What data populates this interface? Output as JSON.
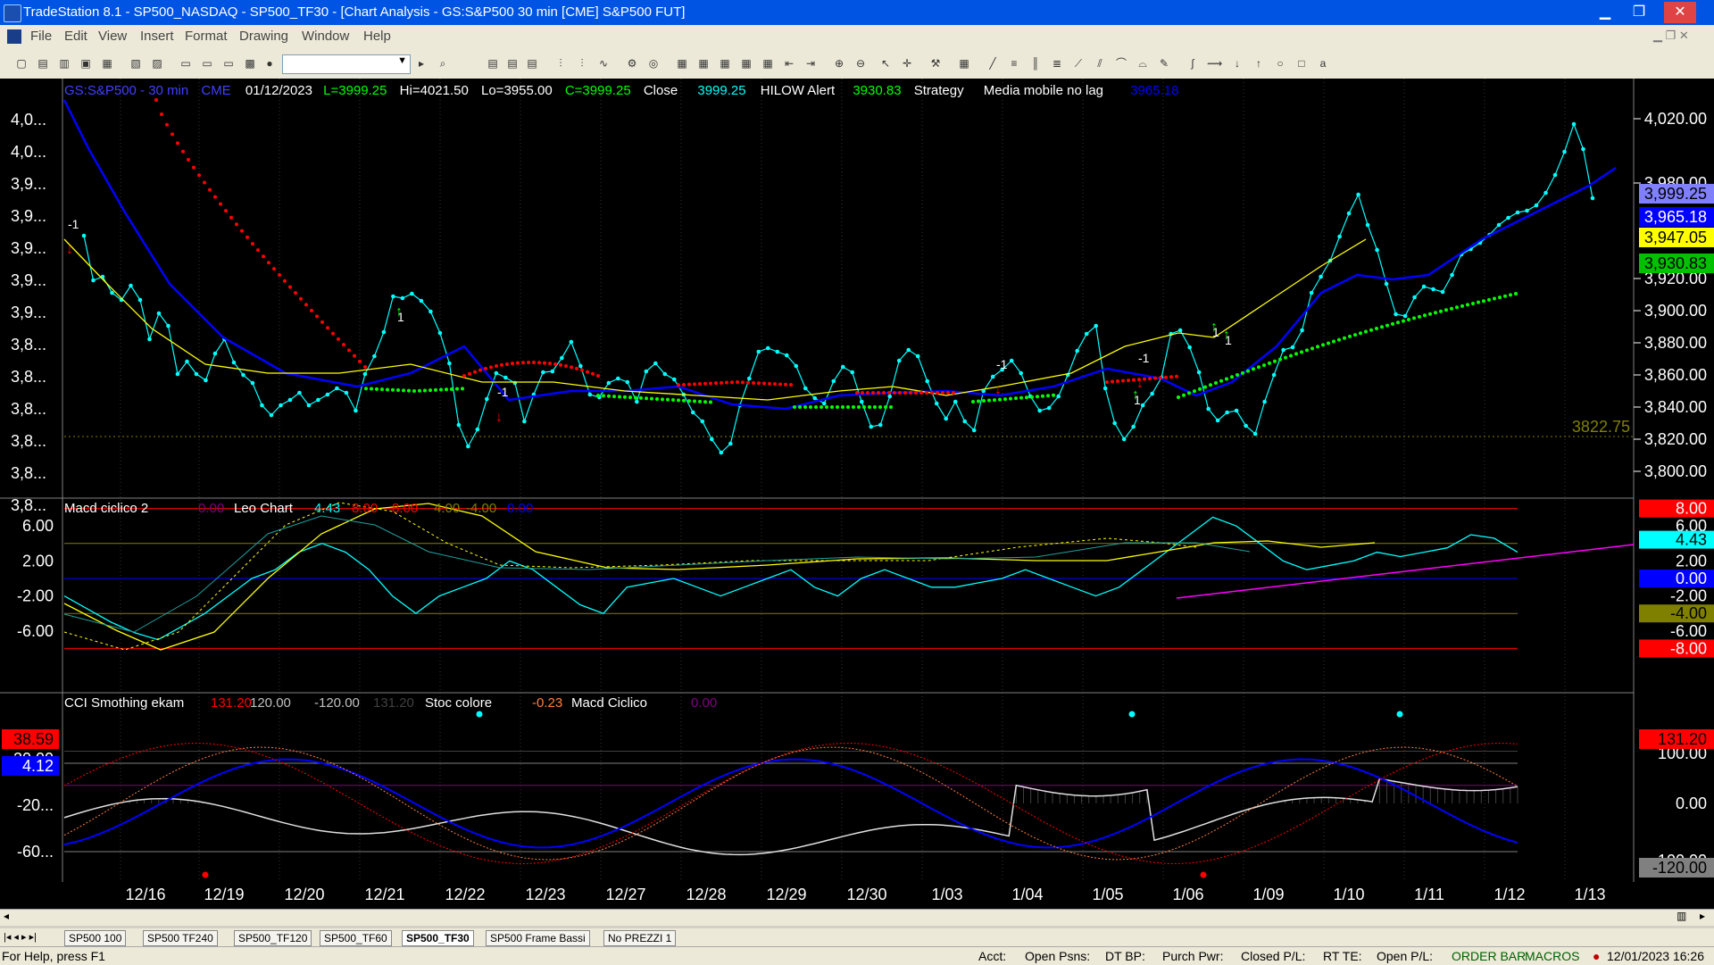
{
  "window": {
    "title": "TradeStation 8.1 - SP500_NASDAQ - SP500_TF30 - [Chart Analysis - GS:S&P500  30 min  [CME] S&P500 FUT]",
    "minimize": "▁",
    "restore": "❐",
    "close": "✕"
  },
  "menu": [
    "File",
    "Edit",
    "View",
    "Insert",
    "Format",
    "Drawing",
    "Window",
    "Help"
  ],
  "header": {
    "symbol": "GS:S&P500 - 30 min",
    "exchange": "CME",
    "date": "01/12/2023",
    "last": "L=3999.25",
    "hi": "Hi=4021.50",
    "lo": "Lo=3955.00",
    "close_eq": "C=3999.25",
    "close_label": "Close",
    "close_value": "3999.25",
    "hilow_label": "HILOW Alert",
    "hilow_value": "3930.83",
    "strategy_label": "Strategy",
    "media_label": "Media mobile no lag",
    "media_value": "3965.18"
  },
  "price_panel": {
    "right_ticks": [
      "4,020.00",
      "3,980.00",
      "3,920.00",
      "3,900.00",
      "3,880.00",
      "3,860.00",
      "3,840.00",
      "3,820.00",
      "3,800.00"
    ],
    "left_ticks": [
      "4,0...",
      "4,0...",
      "3,9...",
      "3,9...",
      "3,9...",
      "3,9...",
      "3,9...",
      "3,8...",
      "3,8...",
      "3,8...",
      "3,8...",
      "3,8...",
      "3,8..."
    ],
    "badges": [
      {
        "text": "3,999.25",
        "bg": "#8080ff",
        "fg": "#000000"
      },
      {
        "text": "3,965.18",
        "bg": "#0000ff",
        "fg": "#ffffff"
      },
      {
        "text": "3,947.05",
        "bg": "#ffff00",
        "fg": "#000000"
      },
      {
        "text": "3,930.83",
        "bg": "#00c000",
        "fg": "#000000"
      }
    ],
    "level_label": "3822.75",
    "signals": [
      {
        "label": "-1",
        "dir": "down"
      },
      {
        "label": "1",
        "dir": "up"
      },
      {
        "label": "-1",
        "dir": "down"
      },
      {
        "label": "1",
        "dir": "up"
      },
      {
        "label": "-1",
        "dir": "down"
      },
      {
        "label": "1",
        "dir": "up"
      },
      {
        "label": "-1",
        "dir": "down"
      },
      {
        "label": "1",
        "dir": "up"
      }
    ]
  },
  "macd_panel": {
    "title": "Macd ciclico 2",
    "legend": [
      {
        "text": "0.00",
        "color": "#800080"
      },
      {
        "text": "Leo Chart",
        "color": "#ffffff"
      },
      {
        "text": "4.43",
        "color": "#00ffff"
      },
      {
        "text": "8.00",
        "color": "#ff0000"
      },
      {
        "text": "-8.00",
        "color": "#ff0000"
      },
      {
        "text": "4.00",
        "color": "#808000"
      },
      {
        "text": "-4.00",
        "color": "#808000"
      },
      {
        "text": "0.00",
        "color": "#0000ff"
      }
    ],
    "left_ticks": [
      "6.00",
      "2.00",
      "-2.00",
      "-6.00"
    ],
    "right_ticks": [
      "6.00",
      "2.00",
      "-2.00",
      "-6.00"
    ],
    "badges": [
      {
        "text": "8.00",
        "bg": "#ff0000",
        "fg": "#ffffff"
      },
      {
        "text": "4.43",
        "bg": "#00ffff",
        "fg": "#000000"
      },
      {
        "text": "0.00",
        "bg": "#0000ff",
        "fg": "#ffffff"
      },
      {
        "text": "-4.00",
        "bg": "#808000",
        "fg": "#000000"
      },
      {
        "text": "-8.00",
        "bg": "#ff0000",
        "fg": "#ffffff"
      }
    ]
  },
  "cci_panel": {
    "legend": [
      {
        "text": "CCI Smothing ekam",
        "color": "#ffffff"
      },
      {
        "text": "131.20",
        "color": "#ff0000"
      },
      {
        "text": "120.00",
        "color": "#c0c0c0"
      },
      {
        "text": "-120.00",
        "color": "#c0c0c0"
      },
      {
        "text": "131.20",
        "color": "#404040"
      },
      {
        "text": "Stoc colore",
        "color": "#ffffff"
      },
      {
        "text": "-0.23",
        "color": "#ff8040"
      },
      {
        "text": "Macd Ciclico",
        "color": "#ffffff"
      },
      {
        "text": "0.00",
        "color": "#800080"
      }
    ],
    "left_ticks": [
      "20.00",
      "-20...",
      "-60..."
    ],
    "right_ticks": [
      "100.00",
      "0.00",
      "-100.00"
    ],
    "left_badges": [
      {
        "text": "38.59",
        "bg": "#ff0000",
        "fg": "#000000"
      },
      {
        "text": "4.12",
        "bg": "#0000ff",
        "fg": "#ffffff"
      }
    ],
    "right_badges": [
      {
        "text": "131.20",
        "bg": "#ff0000",
        "fg": "#000000"
      },
      {
        "text": "-120.00",
        "bg": "#808080",
        "fg": "#000000"
      }
    ]
  },
  "x_dates": [
    "12/16",
    "12/19",
    "12/20",
    "12/21",
    "12/22",
    "12/23",
    "12/27",
    "12/28",
    "12/29",
    "12/30",
    "1/03",
    "1/04",
    "1/05",
    "1/06",
    "1/09",
    "1/10",
    "1/11",
    "1/12",
    "1/13"
  ],
  "tabs": [
    "SP500 100",
    "SP500 TF240",
    "SP500_TF120",
    "SP500_TF60",
    "SP500_TF30",
    "SP500 Frame Bassi",
    "No PREZZI 1"
  ],
  "active_tab": "SP500_TF30",
  "status": {
    "help": "For Help, press F1",
    "acct": "Acct:",
    "open_psns": "Open Psns:",
    "dt_bp": "DT BP:",
    "purch_pwr": "Purch Pwr:",
    "closed_pl": "Closed P/L:",
    "rt_te": "RT TE:",
    "open_pl": "Open P/L:",
    "order_bar": "ORDER BAR",
    "macros": "MACROS",
    "datetime": "12/01/2023 16:26"
  },
  "colors": {
    "bg": "#000000",
    "price_dots": "#00ffff",
    "ma_blue": "#0000ff",
    "ma_yellow": "#ffff00",
    "hilow_red": "#ff0000",
    "hilow_green": "#00ff00",
    "trend": "#ff00ff"
  }
}
